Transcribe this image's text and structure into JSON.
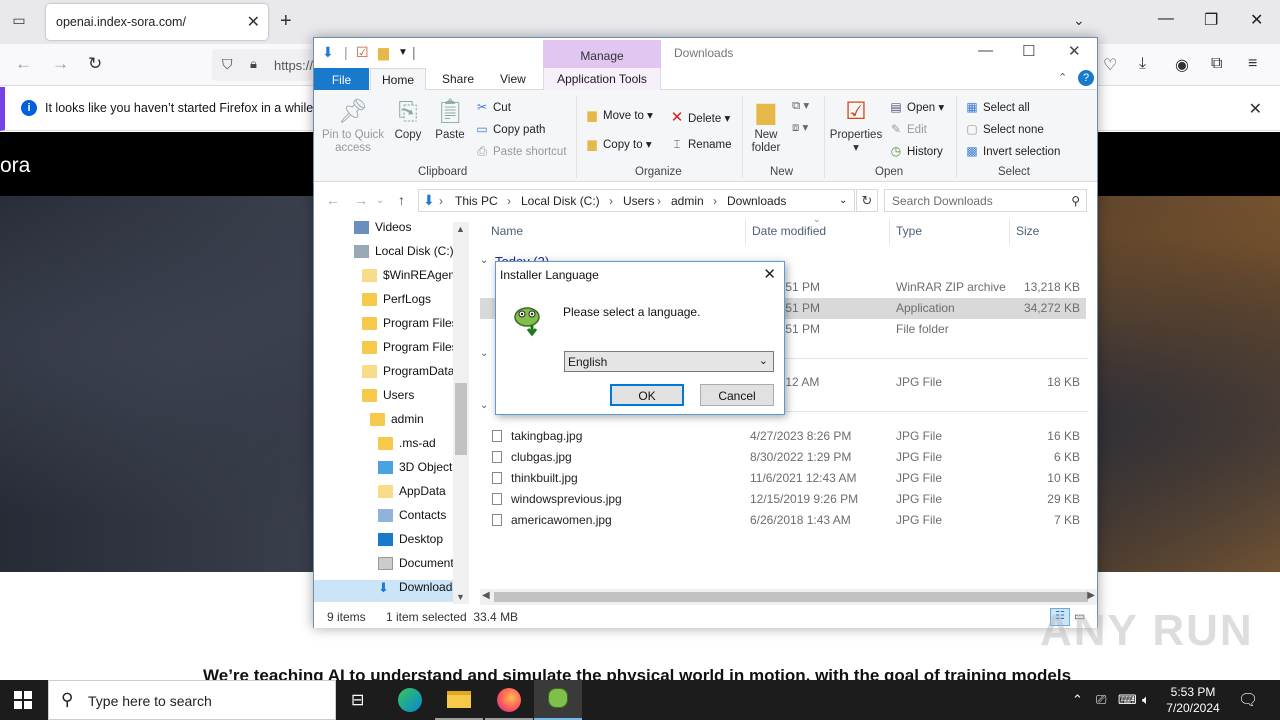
{
  "browser": {
    "tab_title": "openai.index-sora.com/",
    "url": "https://",
    "notice": "It looks like you haven’t started Firefox in a while. D"
  },
  "page": {
    "logo": "ora",
    "tagline": "We’re teaching AI to understand and simulate the physical world in motion, with the goal of training models"
  },
  "explorer": {
    "context_tab": "Manage",
    "title": "Downloads",
    "tabs": {
      "file": "File",
      "home": "Home",
      "share": "Share",
      "view": "View",
      "app_tools": "Application Tools"
    },
    "ribbon": {
      "pin": "Pin to Quick access",
      "copy": "Copy",
      "paste": "Paste",
      "cut": "Cut",
      "copy_path": "Copy path",
      "paste_shortcut": "Paste shortcut",
      "move_to": "Move to",
      "copy_to": "Copy to",
      "delete": "Delete",
      "rename": "Rename",
      "new_folder": "New folder",
      "properties": "Properties",
      "open": "Open",
      "edit": "Edit",
      "history": "History",
      "select_all": "Select all",
      "select_none": "Select none",
      "invert_selection": "Invert selection",
      "groups": {
        "clipboard": "Clipboard",
        "organize": "Organize",
        "new": "New",
        "open": "Open",
        "select": "Select"
      }
    },
    "breadcrumb": [
      "This PC",
      "Local Disk (C:)",
      "Users",
      "admin",
      "Downloads"
    ],
    "search_placeholder": "Search Downloads",
    "nav": [
      {
        "label": "Videos"
      },
      {
        "label": "Local Disk (C:)"
      },
      {
        "label": "$WinREAgent"
      },
      {
        "label": "PerfLogs"
      },
      {
        "label": "Program Files"
      },
      {
        "label": "Program Files"
      },
      {
        "label": "ProgramData"
      },
      {
        "label": "Users"
      },
      {
        "label": "admin"
      },
      {
        "label": ".ms-ad"
      },
      {
        "label": "3D Objects"
      },
      {
        "label": "AppData"
      },
      {
        "label": "Contacts"
      },
      {
        "label": "Desktop"
      },
      {
        "label": "Documents"
      },
      {
        "label": "Downloads"
      }
    ],
    "columns": {
      "name": "Name",
      "date": "Date modified",
      "type": "Type",
      "size": "Size"
    },
    "group_today": "Today (3)",
    "rows_today": [
      {
        "date": "024 5:51 PM",
        "type": "WinRAR ZIP archive",
        "size": "13,218 KB"
      },
      {
        "date": "024 5:51 PM",
        "type": "Application",
        "size": "34,272 KB"
      },
      {
        "date": "024 5:51 PM",
        "type": "File folder",
        "size": ""
      }
    ],
    "row_mid": {
      "date": "024 9:12 AM",
      "type": "JPG File",
      "size": "18 KB"
    },
    "rows_older": [
      {
        "name": "takingbag.jpg",
        "date": "4/27/2023 8:26 PM",
        "type": "JPG File",
        "size": "16 KB"
      },
      {
        "name": "clubgas.jpg",
        "date": "8/30/2022 1:29 PM",
        "type": "JPG File",
        "size": "6 KB"
      },
      {
        "name": "thinkbuilt.jpg",
        "date": "11/6/2021 12:43 AM",
        "type": "JPG File",
        "size": "10 KB"
      },
      {
        "name": "windowsprevious.jpg",
        "date": "12/15/2019 9:26 PM",
        "type": "JPG File",
        "size": "29 KB"
      },
      {
        "name": "americawomen.jpg",
        "date": "6/26/2018 1:43 AM",
        "type": "JPG File",
        "size": "7 KB"
      }
    ],
    "status_items": "9 items",
    "status_selected": "1 item selected  33.4 MB"
  },
  "dialog": {
    "title": "Installer Language",
    "message": "Please select a language.",
    "selected_language": "English",
    "ok": "OK",
    "cancel": "Cancel"
  },
  "taskbar": {
    "search_placeholder": "Type here to search",
    "time": "5:53 PM",
    "date": "7/20/2024"
  },
  "watermark": "ANY RUN"
}
